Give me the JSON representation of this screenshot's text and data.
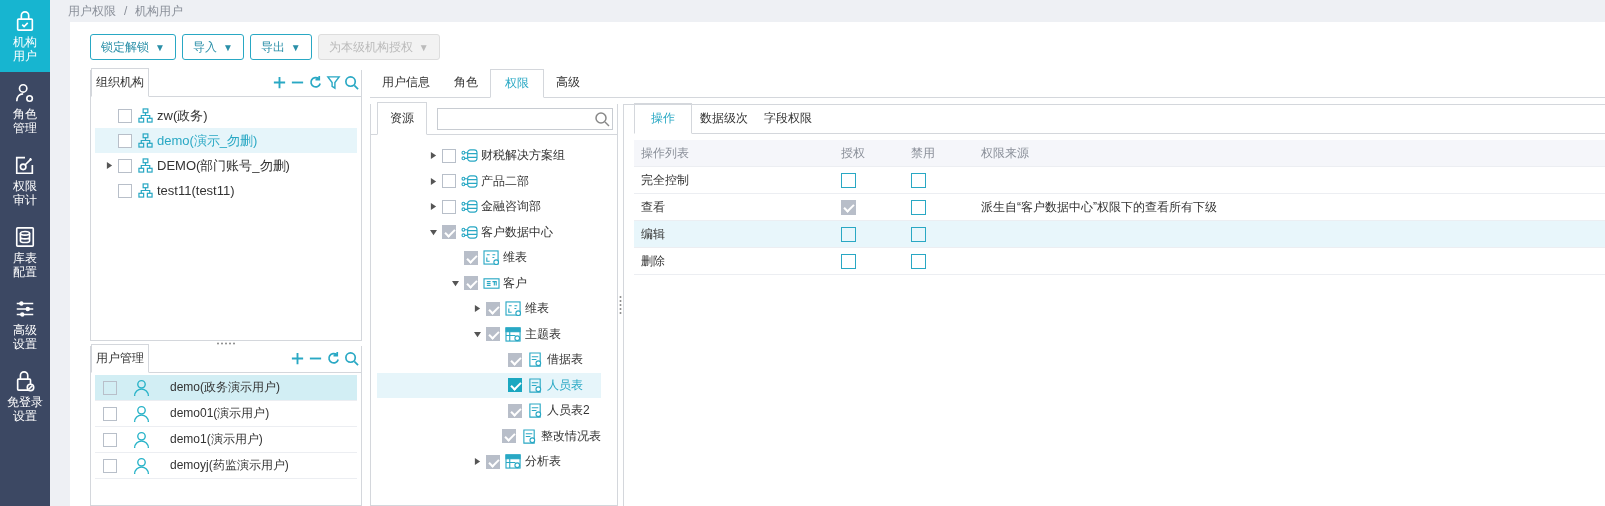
{
  "sidebar": {
    "items": [
      {
        "label": "机构用户",
        "kind": "lock",
        "selected": true
      },
      {
        "label": "角色管理",
        "kind": "role",
        "selected": false
      },
      {
        "label": "权限审计",
        "kind": "audit",
        "selected": false
      },
      {
        "label": "库表配置",
        "kind": "database",
        "selected": false
      },
      {
        "label": "高级设置",
        "kind": "sliders",
        "selected": false
      },
      {
        "label": "免登录设置",
        "kind": "nologin",
        "selected": false
      }
    ]
  },
  "breadcrumb": [
    "用户权限",
    "/",
    "机构用户"
  ],
  "toolbar": [
    {
      "label": "锁定解锁",
      "caret": "▼",
      "disabled": false
    },
    {
      "label": "导入",
      "caret": "▼",
      "disabled": false
    },
    {
      "label": "导出",
      "caret": "▼",
      "disabled": false
    },
    {
      "label": "为本级机构授权",
      "caret": "▼",
      "disabled": true
    }
  ],
  "org_panel": {
    "title": "组织机构",
    "items": [
      {
        "label": "zw(政务)",
        "checked": false,
        "selected": false
      },
      {
        "label": "demo(演示_勿删)",
        "checked": false,
        "selected": true
      },
      {
        "label": "DEMO(部门账号_勿删)",
        "expanded": false,
        "checked": false,
        "selected": false
      },
      {
        "label": "test11(test11)",
        "checked": false,
        "selected": false
      }
    ]
  },
  "user_panel": {
    "title": "用户管理",
    "users": [
      {
        "label": "demo(政务演示用户)",
        "checked": false,
        "selected": true
      },
      {
        "label": "demo01(演示用户)",
        "checked": false,
        "selected": false
      },
      {
        "label": "demo1(演示用户)",
        "checked": false,
        "selected": false
      },
      {
        "label": "demoyj(药监演示用户)",
        "checked": false,
        "selected": false
      }
    ]
  },
  "detail_tabs": [
    {
      "label": "用户信息",
      "selected": false
    },
    {
      "label": "角色",
      "selected": false
    },
    {
      "label": "权限",
      "selected": true
    },
    {
      "label": "高级",
      "selected": false
    }
  ],
  "resource_panel": {
    "title": "资源",
    "tree": [
      {
        "label": "财税解决方案组",
        "kind": "group",
        "expanded": false,
        "checked": false,
        "disabled": false,
        "selected": false
      },
      {
        "label": "产品二部",
        "kind": "group",
        "expanded": false,
        "checked": false,
        "disabled": false,
        "selected": false
      },
      {
        "label": "金融咨询部",
        "kind": "group",
        "expanded": false,
        "checked": false,
        "disabled": false,
        "selected": false
      },
      {
        "label": "客户数据中心",
        "kind": "group",
        "expanded": true,
        "checked": true,
        "disabled": true,
        "selected": false,
        "children": [
          {
            "label": "维表",
            "kind": "dimension",
            "checked": true,
            "disabled": true,
            "selected": false
          },
          {
            "label": "客户",
            "kind": "market",
            "expanded": true,
            "checked": true,
            "disabled": true,
            "selected": false,
            "children": [
              {
                "label": "维表",
                "kind": "dimension",
                "expanded": false,
                "checked": true,
                "disabled": true,
                "selected": false
              },
              {
                "label": "主题表",
                "kind": "subject",
                "expanded": true,
                "checked": true,
                "disabled": true,
                "selected": false,
                "children": [
                  {
                    "label": "借据表",
                    "kind": "table",
                    "checked": true,
                    "disabled": true,
                    "selected": false
                  },
                  {
                    "label": "人员表",
                    "kind": "table",
                    "checked": true,
                    "disabled": false,
                    "selected": true
                  },
                  {
                    "label": "人员表2",
                    "kind": "table",
                    "checked": true,
                    "disabled": true,
                    "selected": false
                  },
                  {
                    "label": "整改情况表",
                    "kind": "table",
                    "checked": true,
                    "disabled": true,
                    "selected": false
                  }
                ]
              },
              {
                "label": "分析表",
                "kind": "subject",
                "expanded": false,
                "checked": true,
                "disabled": true,
                "selected": false
              }
            ]
          }
        ]
      }
    ]
  },
  "permission_tabs": [
    {
      "label": "操作",
      "selected": true
    },
    {
      "label": "数据级次",
      "selected": false
    },
    {
      "label": "字段权限",
      "selected": false
    }
  ],
  "permission_table": {
    "columns": [
      "操作列表",
      "授权",
      "禁用",
      "权限来源"
    ],
    "rows": [
      {
        "operation": "完全控制",
        "grant": false,
        "grant_disabled": false,
        "deny": false,
        "selected": false
      },
      {
        "operation": "查看",
        "grant": true,
        "grant_disabled": true,
        "deny": false,
        "source": "派生自“客户数据中心”权限下的查看所有下级",
        "selected": false
      },
      {
        "operation": "编辑",
        "grant": false,
        "grant_disabled": false,
        "deny": false,
        "selected": true
      },
      {
        "operation": "删除",
        "grant": false,
        "grant_disabled": false,
        "deny": false,
        "selected": false
      }
    ]
  }
}
